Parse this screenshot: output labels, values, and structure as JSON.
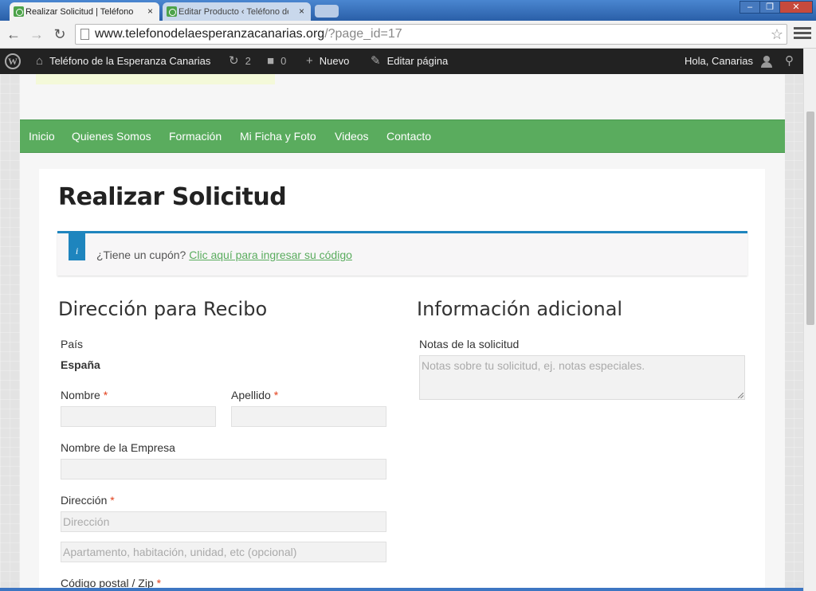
{
  "browser": {
    "tabs": [
      {
        "title": "Realizar Solicitud | Teléfono d",
        "close": "×"
      },
      {
        "title": "Editar Producto ‹ Teléfono de",
        "close": "×"
      }
    ],
    "window_controls": {
      "minimize": "–",
      "maximize": "❐",
      "close": "✕"
    },
    "url_host": "www.telefonodelaesperanzacanarias.org",
    "url_path": "/?page_id=17",
    "icons": {
      "back": "←",
      "forward": "→",
      "reload": "↻",
      "star": "☆"
    }
  },
  "adminbar": {
    "site_name": "Teléfono de la Esperanza Canarias",
    "updates_count": "2",
    "comments_count": "0",
    "new_label": "Nuevo",
    "edit_label": "Editar página",
    "howdy": "Hola, Canarias",
    "icons": {
      "wp": "W",
      "home": "⌂",
      "updates": "↻",
      "comments": "■",
      "new": "+",
      "edit": "✎",
      "search": "⚲"
    }
  },
  "nav": {
    "items": [
      "Inicio",
      "Quienes Somos",
      "Formación",
      "Mi Ficha y Foto",
      "Videos",
      "Contacto"
    ]
  },
  "page": {
    "title": "Realizar Solicitud",
    "coupon_prompt": "¿Tiene un cupón?",
    "coupon_link": "Clic aquí para ingresar su código",
    "info_icon": "i"
  },
  "billing": {
    "heading": "Dirección para Recibo",
    "country_label": "País",
    "country_value": "España",
    "first_name_label": "Nombre",
    "last_name_label": "Apellido",
    "company_label": "Nombre de la Empresa",
    "address_label": "Dirección",
    "address_placeholder": "Dirección",
    "address2_placeholder": "Apartamento, habitación, unidad, etc (opcional)",
    "postcode_label": "Código postal / Zip",
    "required_mark": "*"
  },
  "additional": {
    "heading": "Información adicional",
    "notes_label": "Notas de la solicitud",
    "notes_placeholder": "Notas sobre tu solicitud, ej. notas especiales."
  },
  "colors": {
    "nav_green": "#5aac5e",
    "link_green": "#5aac5e",
    "info_blue": "#1e85be",
    "required_red": "#e2401c",
    "adminbar_bg": "#222222"
  }
}
